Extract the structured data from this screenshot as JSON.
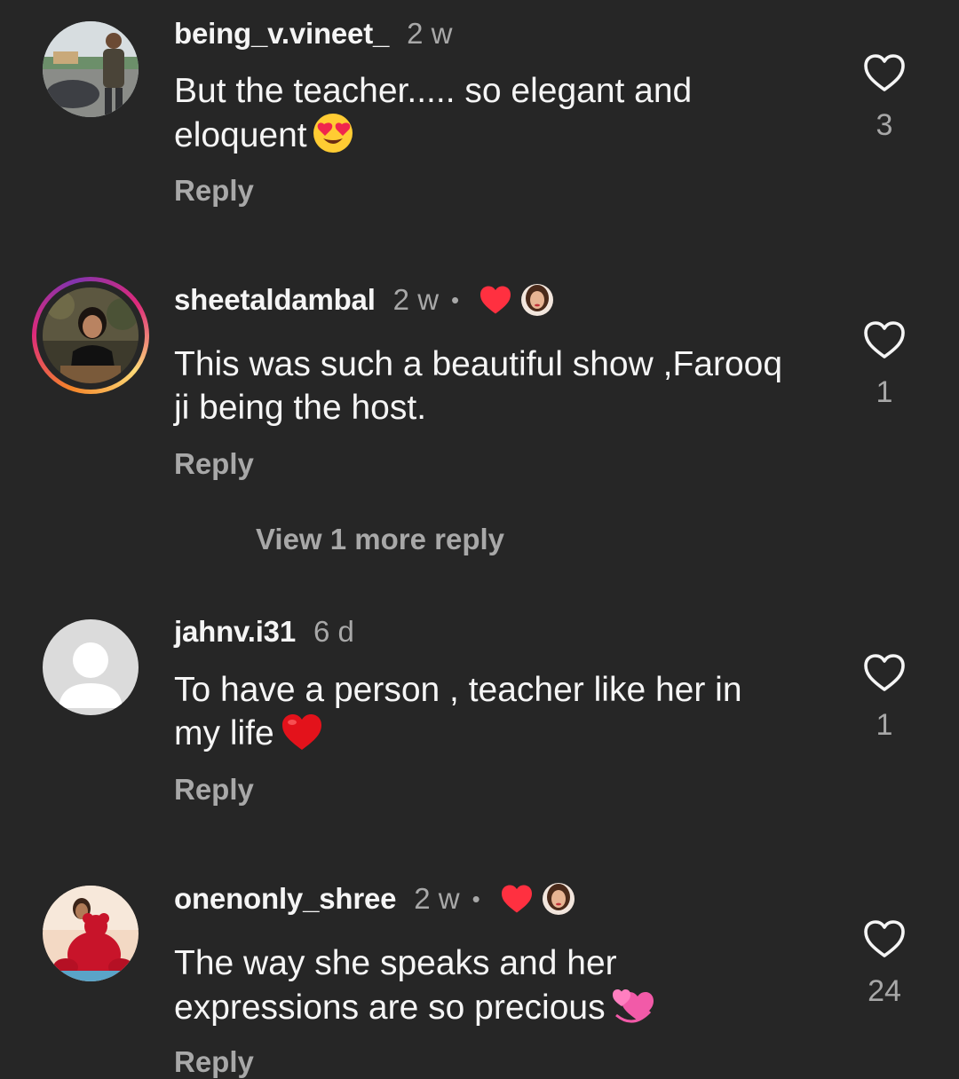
{
  "comments": [
    {
      "username": "being_v.vineet_",
      "time": "2 w",
      "text": "But the teacher..... so elegant and eloquent",
      "emoji": "heart-eyes-emoji",
      "reply_label": "Reply",
      "like_count": "3",
      "liked_by_creator": false
    },
    {
      "username": "sheetaldambal",
      "time": "2 w",
      "separator": "•",
      "text": "This was such a beautiful show ,Farooq ji being the host.",
      "reply_label": "Reply",
      "like_count": "1",
      "liked_by_creator": true,
      "view_more_label": "View 1 more reply"
    },
    {
      "username": "jahnv.i31",
      "time": "6 d",
      "text": "To have a person , teacher like her in my life",
      "emoji": "red-heart-emoji",
      "reply_label": "Reply",
      "like_count": "1",
      "liked_by_creator": false
    },
    {
      "username": "onenonly_shree",
      "time": "2 w",
      "separator": "•",
      "text": "The way she speaks and her expressions are so precious",
      "emoji": "revolving-hearts-emoji",
      "reply_label": "Reply",
      "like_count": "24",
      "liked_by_creator": true
    }
  ],
  "colors": {
    "background": "#262626",
    "primary_text": "#f5f5f5",
    "secondary_text": "#a8a8a8",
    "heart_red": "#ff3040"
  }
}
